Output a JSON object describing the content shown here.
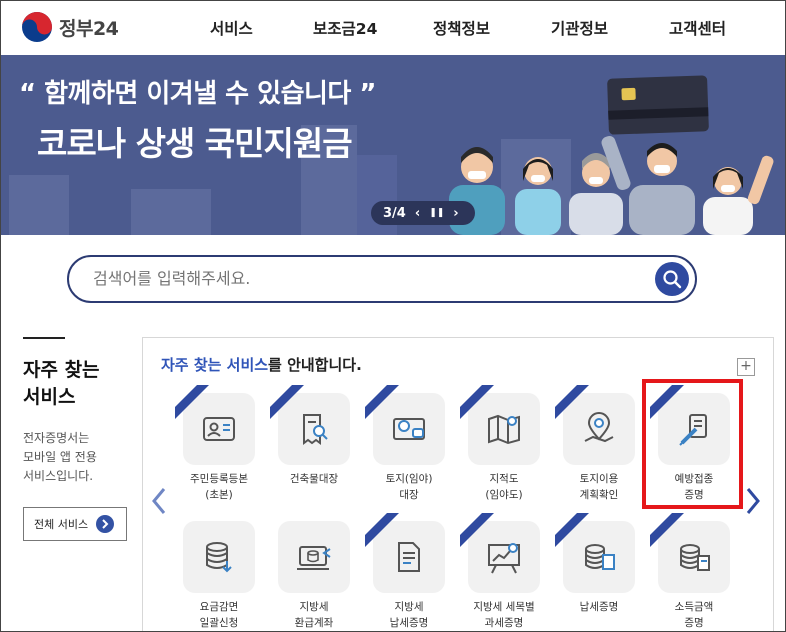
{
  "header": {
    "logo_text": "정부24",
    "nav": [
      "서비스",
      "보조금24",
      "정책정보",
      "기관정보",
      "고객센터"
    ]
  },
  "banner": {
    "line1": "“ 함께하면 이겨낼 수 있습니다 ”",
    "line2": "코로나 상생 국민지원금",
    "pager": "3/4",
    "background": "#4c5b8f"
  },
  "search": {
    "placeholder": "검색어를 입력해주세요."
  },
  "sidebar": {
    "title_line1": "자주 찾는",
    "title_line2": "서비스",
    "desc_line1": "전자증명서는",
    "desc_line2": "모바일 앱 전용",
    "desc_line3": "서비스입니다.",
    "all_button": "전체 서비스"
  },
  "services": {
    "title_highlight": "자주 찾는 서비스",
    "title_rest": "를 안내합니다.",
    "plus_label": "+",
    "ribbon_text": "전자증명서",
    "items": [
      {
        "l1": "주민등록등본",
        "l2": "(초본)",
        "icon": "id-card-icon",
        "ribbon": true
      },
      {
        "l1": "건축물대장",
        "l2": "",
        "icon": "document-search-icon",
        "ribbon": true
      },
      {
        "l1": "토지(임야)",
        "l2": "대장",
        "icon": "land-map-icon",
        "ribbon": true
      },
      {
        "l1": "지적도",
        "l2": "(임야도)",
        "icon": "folded-map-icon",
        "ribbon": true
      },
      {
        "l1": "토지이용",
        "l2": "계획확인",
        "icon": "map-pin-icon",
        "ribbon": true
      },
      {
        "l1": "예방접종",
        "l2": "증명",
        "icon": "vaccine-icon",
        "ribbon": true
      },
      {
        "l1": "요금감면",
        "l2": "일괄신청",
        "icon": "database-icon",
        "ribbon": false
      },
      {
        "l1": "지방세",
        "l2": "환급계좌",
        "icon": "laptop-database-icon",
        "ribbon": false
      },
      {
        "l1": "지방세",
        "l2": "납세증명",
        "icon": "tax-document-icon",
        "ribbon": true
      },
      {
        "l1": "지방세 세목별",
        "l2": "과세증명",
        "icon": "chart-board-icon",
        "ribbon": true
      },
      {
        "l1": "납세증명",
        "l2": "",
        "icon": "tax-database-icon",
        "ribbon": true
      },
      {
        "l1": "소득금액",
        "l2": "증명",
        "icon": "income-database-icon",
        "ribbon": true
      }
    ]
  },
  "colors": {
    "accent": "#2f54b8",
    "highlight_box": "#e5171a",
    "navy": "#2c3b73"
  }
}
